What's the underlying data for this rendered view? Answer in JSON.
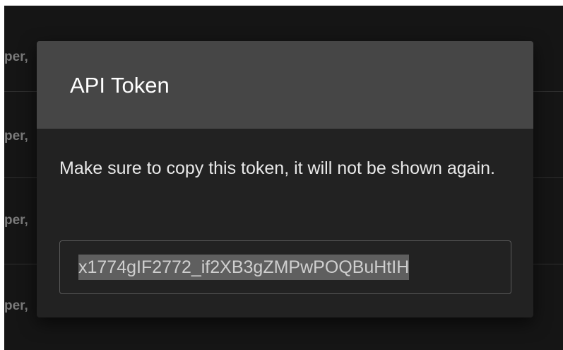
{
  "background_rows": [
    {
      "label": "per,"
    },
    {
      "label": "per,"
    },
    {
      "label": "per,"
    },
    {
      "label": "per,"
    }
  ],
  "dialog": {
    "title": "API Token",
    "message": "Make sure to copy this token, it will not be shown again.",
    "token_value": "x1774gIF2772_if2XB3gZMPwPOQBuHtIH",
    "token_selected": true
  },
  "colors": {
    "backdrop": "#151515",
    "dialog_body": "#222222",
    "dialog_header": "#464646",
    "selection": "#5f5f5f"
  }
}
